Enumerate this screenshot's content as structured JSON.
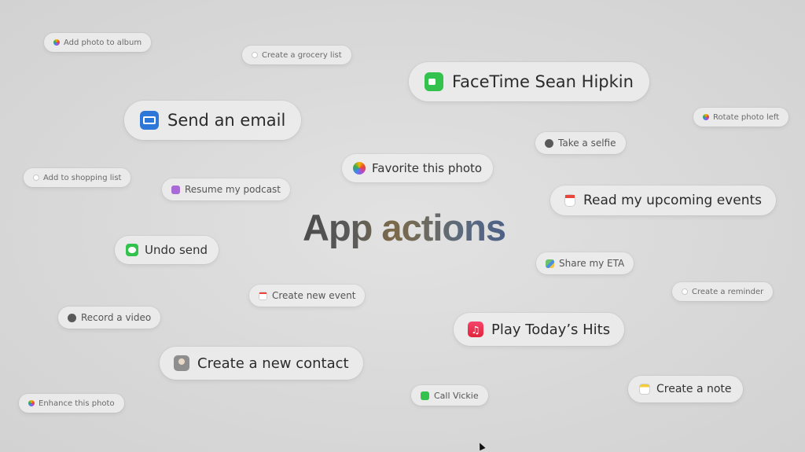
{
  "title": "App actions",
  "actions": {
    "add_photo_to_album": "Add photo to album",
    "create_grocery_list": "Create a grocery list",
    "facetime_sean_hipkin": "FaceTime Sean Hipkin",
    "rotate_photo_left": "Rotate photo left",
    "send_an_email": "Send an email",
    "take_a_selfie": "Take a selfie",
    "favorite_this_photo": "Favorite this photo",
    "add_to_shopping_list": "Add to shopping list",
    "resume_my_podcast": "Resume my podcast",
    "read_my_upcoming_events": "Read my upcoming events",
    "undo_send": "Undo send",
    "share_my_eta": "Share my ETA",
    "create_new_event": "Create new event",
    "create_a_reminder": "Create a reminder",
    "record_a_video": "Record a video",
    "play_todays_hits": "Play Today’s Hits",
    "create_a_new_contact": "Create a new contact",
    "create_a_note": "Create a note",
    "call_vickie": "Call Vickie",
    "enhance_this_photo": "Enhance this photo"
  },
  "icons": {
    "photos": "photos-icon",
    "reminders": "reminders-icon",
    "notes": "notes-icon",
    "camera": "camera-icon",
    "calendar": "calendar-icon",
    "podcasts": "podcasts-icon",
    "mail": "mail-icon",
    "facetime": "facetime-icon",
    "messages": "messages-icon",
    "music": "music-icon",
    "contacts": "contacts-icon",
    "phone": "phone-icon",
    "maps": "maps-icon"
  },
  "colors": {
    "background": "#d9d9d9",
    "mail": "#2d77d8",
    "facetime": "#33c24d",
    "music": "#e2243c",
    "podcasts": "#a86ad6"
  }
}
